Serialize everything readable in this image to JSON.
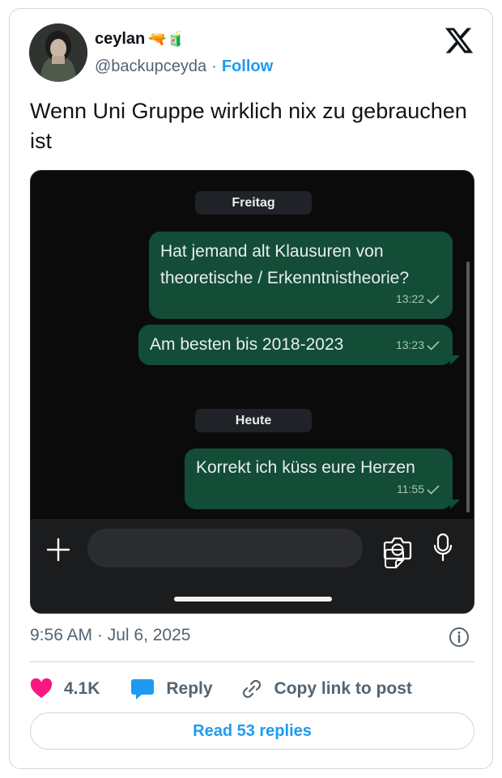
{
  "author": {
    "name": "ceylan",
    "name_suffix": "🔫🧃",
    "handle": "@backupceyda",
    "separator": "·",
    "follow_label": "Follow"
  },
  "tweet": {
    "text": "Wenn Uni Gruppe wirklich nix zu gebrauchen ist"
  },
  "chat": {
    "days": [
      {
        "label": "Freitag"
      },
      {
        "label": "Heute"
      }
    ],
    "messages": [
      {
        "text": "Hat jemand alt Klausuren von theoretische / Erkenntnistheorie?",
        "time": "13:22"
      },
      {
        "text": "Am besten bis 2018-2023",
        "time": "13:23"
      },
      {
        "text": "Korrekt ich küss eure Herzen",
        "time": "11:55"
      }
    ],
    "bubble_color": "#134d37",
    "background_color": "#0b0b0b"
  },
  "meta": {
    "timestamp": "9:56 AM · Jul 6, 2025"
  },
  "actions": {
    "likes_count": "4.1K",
    "reply_label": "Reply",
    "copy_link_label": "Copy link to post"
  },
  "footer": {
    "read_replies_label": "Read 53 replies"
  },
  "colors": {
    "accent": "#1d9bf0",
    "like": "#f91880",
    "reply_icon": "#1d9bf0"
  }
}
